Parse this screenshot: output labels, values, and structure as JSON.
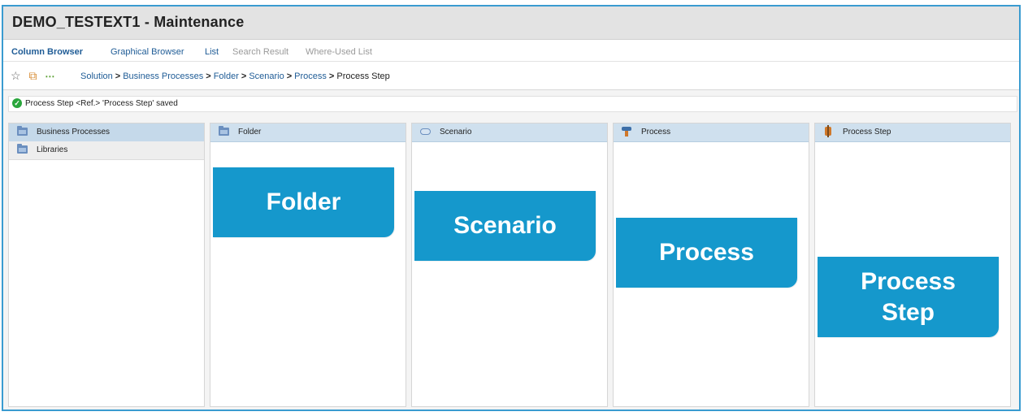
{
  "window": {
    "title": "DEMO_TESTEXT1 - Maintenance"
  },
  "tabs": [
    {
      "label": "Column Browser",
      "state": "active"
    },
    {
      "label": "Graphical Browser",
      "state": "link"
    },
    {
      "label": "List",
      "state": "link"
    },
    {
      "label": "Search Result",
      "state": "disabled"
    },
    {
      "label": "Where-Used List",
      "state": "disabled"
    }
  ],
  "toolbar": {
    "icons": [
      "favorites-star-icon",
      "copy-icon",
      "more-dots-icon"
    ]
  },
  "breadcrumb": {
    "items": [
      "Solution",
      "Business Processes",
      "Folder",
      "Scenario",
      "Process"
    ],
    "separator": ">",
    "current": "Process Step"
  },
  "message": {
    "status": "success",
    "text": "Process Step <Ref.> 'Process Step' saved"
  },
  "columns": [
    {
      "header": "Business Processes",
      "icon": "folder-icon",
      "rows": [
        "Libraries"
      ]
    },
    {
      "header": "Folder",
      "icon": "folder-icon",
      "callout": "Folder"
    },
    {
      "header": "Scenario",
      "icon": "scenario-icon",
      "callout": "Scenario"
    },
    {
      "header": "Process",
      "icon": "process-icon",
      "callout": "Process"
    },
    {
      "header": "Process Step",
      "icon": "process-step-icon",
      "callout_line1": "Process",
      "callout_line2": "Step"
    }
  ],
  "colors": {
    "accent": "#1598cc",
    "header_bg": "#cfe0ee",
    "link": "#1f5c96",
    "success": "#2aa63c",
    "frame_border": "#3a9bd0"
  }
}
